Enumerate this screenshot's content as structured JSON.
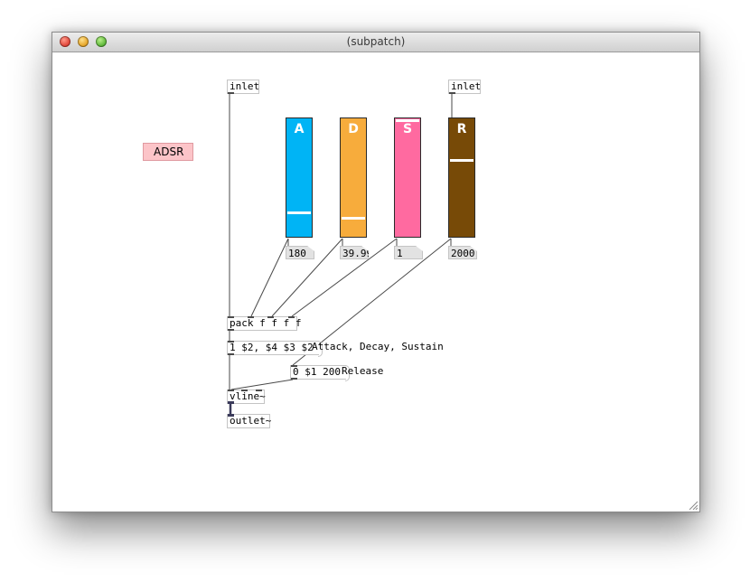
{
  "window": {
    "title": "(subpatch)"
  },
  "canvas_label": "ADSR",
  "objects": {
    "inlet_left": "inlet",
    "inlet_right": "inlet",
    "pack": "pack f f f f",
    "msg_ads": "1 $2, $4 $3 $2",
    "msg_release": "0 $1 200",
    "vline": "vline~",
    "outlet": "outlet~"
  },
  "comments": {
    "ads": "Attack, Decay, Sustain",
    "release": "Release"
  },
  "sliders": [
    {
      "label": "A",
      "color": "#00b4f5",
      "level": 0.2,
      "number": "180"
    },
    {
      "label": "D",
      "color": "#f7ac3c",
      "level": 0.16,
      "number": "39.99"
    },
    {
      "label": "S",
      "color": "#ff6aa0",
      "level": 1.0,
      "number": "1"
    },
    {
      "label": "R",
      "color": "#774a07",
      "level": 0.66,
      "number": "2000."
    }
  ]
}
